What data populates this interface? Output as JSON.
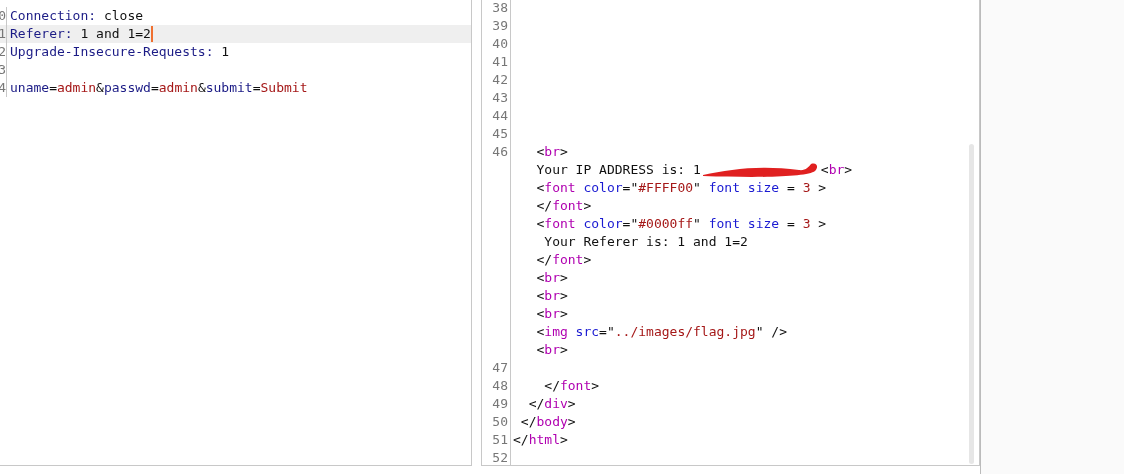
{
  "request": {
    "lines": [
      {
        "number": "0",
        "tokens": [
          {
            "kind": "key",
            "text": "Connection:"
          },
          {
            "kind": "plain",
            "text": " close"
          }
        ]
      },
      {
        "number": "1",
        "highlighted": true,
        "cursor": true,
        "tokens": [
          {
            "kind": "key",
            "text": "Referer:"
          },
          {
            "kind": "plain",
            "text": " 1 and 1=2"
          }
        ]
      },
      {
        "number": "2",
        "tokens": [
          {
            "kind": "key",
            "text": "Upgrade-Insecure-Requests:"
          },
          {
            "kind": "plain",
            "text": " 1"
          }
        ]
      },
      {
        "number": "3"
      },
      {
        "number": "4",
        "tokens": [
          {
            "kind": "param",
            "text": "uname"
          },
          {
            "kind": "plain",
            "text": "="
          },
          {
            "kind": "value",
            "text": "admin"
          },
          {
            "kind": "plain",
            "text": "&"
          },
          {
            "kind": "param",
            "text": "passwd"
          },
          {
            "kind": "plain",
            "text": "="
          },
          {
            "kind": "value",
            "text": "admin"
          },
          {
            "kind": "plain",
            "text": "&"
          },
          {
            "kind": "param",
            "text": "submit"
          },
          {
            "kind": "plain",
            "text": "="
          },
          {
            "kind": "value",
            "text": "Submit"
          }
        ]
      }
    ]
  },
  "response": {
    "lines": [
      {
        "number": "38"
      },
      {
        "number": "39"
      },
      {
        "number": "40"
      },
      {
        "number": "41"
      },
      {
        "number": "42"
      },
      {
        "number": "43"
      },
      {
        "number": "44"
      },
      {
        "number": "45"
      },
      {
        "number": "46",
        "rows": [
          {
            "tokens": [
              {
                "kind": "punct",
                "text": "   <"
              },
              {
                "kind": "tag",
                "text": "br"
              },
              {
                "kind": "punct",
                "text": ">"
              }
            ]
          },
          {
            "tokens": [
              {
                "kind": "text",
                "text": "   Your IP ADDRESS is: 1"
              },
              {
                "kind": "redaction"
              },
              {
                "kind": "punct",
                "text": "<"
              },
              {
                "kind": "tag",
                "text": "br"
              },
              {
                "kind": "punct",
                "text": ">"
              }
            ]
          },
          {
            "tokens": [
              {
                "kind": "punct",
                "text": "   <"
              },
              {
                "kind": "tag",
                "text": "font"
              },
              {
                "kind": "attr",
                "text": " color"
              },
              {
                "kind": "punct",
                "text": "=\""
              },
              {
                "kind": "str",
                "text": "#FFFF00"
              },
              {
                "kind": "punct",
                "text": "\""
              },
              {
                "kind": "attr",
                "text": " font size"
              },
              {
                "kind": "punct",
                "text": " = "
              },
              {
                "kind": "str",
                "text": "3"
              },
              {
                "kind": "punct",
                "text": " >"
              }
            ]
          },
          {
            "tokens": [
              {
                "kind": "punct",
                "text": "   </"
              },
              {
                "kind": "tag",
                "text": "font"
              },
              {
                "kind": "punct",
                "text": ">"
              }
            ]
          },
          {
            "tokens": [
              {
                "kind": "punct",
                "text": "   <"
              },
              {
                "kind": "tag",
                "text": "font"
              },
              {
                "kind": "attr",
                "text": " color"
              },
              {
                "kind": "punct",
                "text": "=\""
              },
              {
                "kind": "str",
                "text": "#0000ff"
              },
              {
                "kind": "punct",
                "text": "\""
              },
              {
                "kind": "attr",
                "text": " font size"
              },
              {
                "kind": "punct",
                "text": " = "
              },
              {
                "kind": "str",
                "text": "3"
              },
              {
                "kind": "punct",
                "text": " >"
              }
            ]
          },
          {
            "tokens": [
              {
                "kind": "text",
                "text": "    Your Referer is: 1 and 1=2"
              }
            ]
          },
          {
            "tokens": [
              {
                "kind": "punct",
                "text": "   </"
              },
              {
                "kind": "tag",
                "text": "font"
              },
              {
                "kind": "punct",
                "text": ">"
              }
            ]
          },
          {
            "tokens": [
              {
                "kind": "punct",
                "text": "   <"
              },
              {
                "kind": "tag",
                "text": "br"
              },
              {
                "kind": "punct",
                "text": ">"
              }
            ]
          },
          {
            "tokens": [
              {
                "kind": "punct",
                "text": "   <"
              },
              {
                "kind": "tag",
                "text": "br"
              },
              {
                "kind": "punct",
                "text": ">"
              }
            ]
          },
          {
            "tokens": [
              {
                "kind": "punct",
                "text": "   <"
              },
              {
                "kind": "tag",
                "text": "br"
              },
              {
                "kind": "punct",
                "text": ">"
              }
            ]
          },
          {
            "tokens": [
              {
                "kind": "punct",
                "text": "   <"
              },
              {
                "kind": "tag",
                "text": "img"
              },
              {
                "kind": "attr",
                "text": " src"
              },
              {
                "kind": "punct",
                "text": "=\""
              },
              {
                "kind": "str",
                "text": "../images/flag.jpg"
              },
              {
                "kind": "punct",
                "text": "\" />"
              }
            ]
          },
          {
            "tokens": [
              {
                "kind": "punct",
                "text": "   <"
              },
              {
                "kind": "tag",
                "text": "br"
              },
              {
                "kind": "punct",
                "text": ">"
              }
            ]
          }
        ]
      },
      {
        "number": "47"
      },
      {
        "number": "48",
        "rows": [
          {
            "tokens": [
              {
                "kind": "punct",
                "text": "    </"
              },
              {
                "kind": "tag",
                "text": "font"
              },
              {
                "kind": "punct",
                "text": ">"
              }
            ]
          }
        ]
      },
      {
        "number": "49",
        "rows": [
          {
            "tokens": [
              {
                "kind": "punct",
                "text": "  </"
              },
              {
                "kind": "tag",
                "text": "div"
              },
              {
                "kind": "punct",
                "text": ">"
              }
            ]
          }
        ]
      },
      {
        "number": "50",
        "rows": [
          {
            "tokens": [
              {
                "kind": "punct",
                "text": " </"
              },
              {
                "kind": "tag",
                "text": "body"
              },
              {
                "kind": "punct",
                "text": ">"
              }
            ]
          }
        ]
      },
      {
        "number": "51",
        "rows": [
          {
            "tokens": [
              {
                "kind": "punct",
                "text": "</"
              },
              {
                "kind": "tag",
                "text": "html"
              },
              {
                "kind": "punct",
                "text": ">"
              }
            ]
          }
        ]
      },
      {
        "number": "52"
      }
    ]
  }
}
